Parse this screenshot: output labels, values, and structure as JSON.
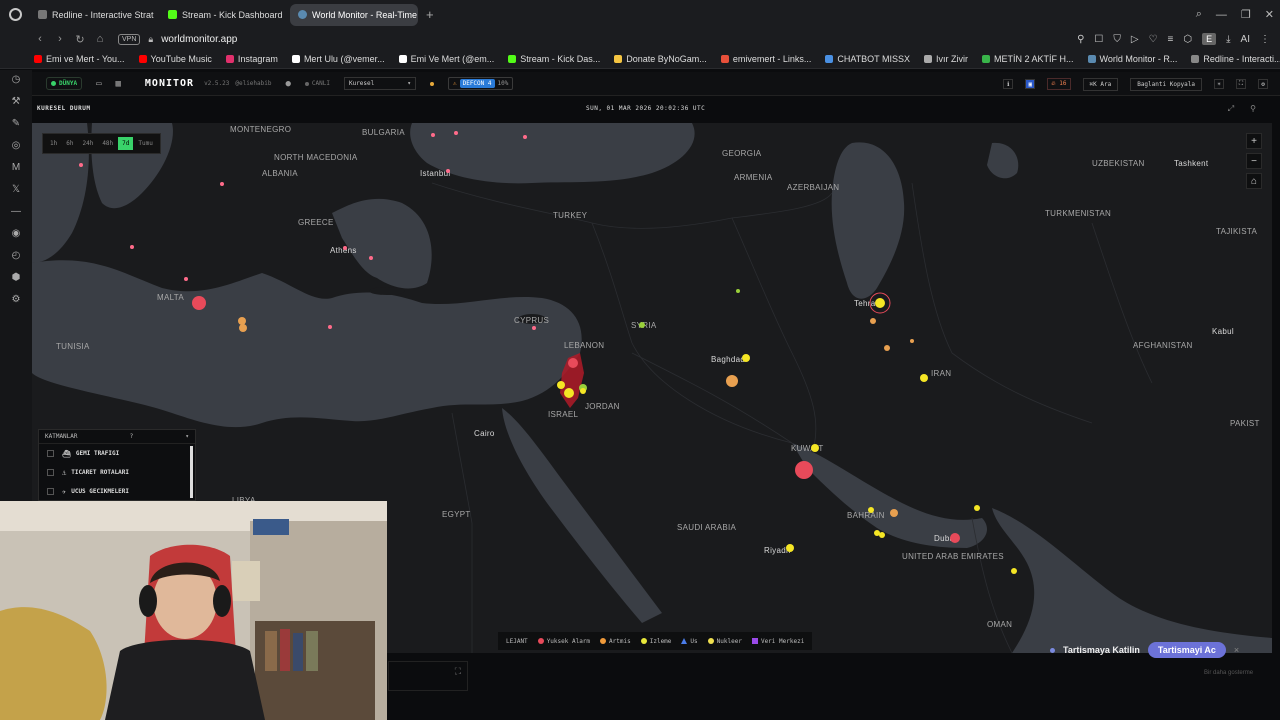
{
  "browser": {
    "tabs": [
      {
        "label": "Redline - Interactive Strat",
        "color": "#888888",
        "active": false
      },
      {
        "label": "Stream - Kick Dashboard",
        "color": "#53fc18",
        "active": false
      },
      {
        "label": "World Monitor - Real-Time",
        "color": "#5a8ab0",
        "active": true
      }
    ],
    "url": "worldmonitor.app",
    "vpn_label": "VPN",
    "ext_label": "AI",
    "e_label": "E",
    "bookmarks": [
      {
        "label": "Emi ve Mert - You...",
        "color": "#ff0000"
      },
      {
        "label": "YouTube Music",
        "color": "#ff0000"
      },
      {
        "label": "Instagram",
        "color": "#e1306c"
      },
      {
        "label": "Mert Ulu (@vemer...",
        "color": "#ffffff"
      },
      {
        "label": "Emi Ve Mert (@em...",
        "color": "#ffffff"
      },
      {
        "label": "Stream - Kick Das...",
        "color": "#53fc18"
      },
      {
        "label": "Donate ByNoGam...",
        "color": "#f5c542"
      },
      {
        "label": "emivemert - Links...",
        "color": "#e8503a"
      },
      {
        "label": "CHATBOT MISSX",
        "color": "#4a90e2"
      },
      {
        "label": "Ivır Zivir",
        "color": "#aaaaaa"
      },
      {
        "label": "METİN 2 AKTİF H...",
        "color": "#39b54a"
      },
      {
        "label": "World Monitor - R...",
        "color": "#5a8ab0"
      },
      {
        "label": "Redline - Interacti...",
        "color": "#888888"
      }
    ]
  },
  "app": {
    "mode_badge": "DÜNYA",
    "brand": "MONITOR",
    "version": "v2.5.23",
    "author": "@eliehabib",
    "live": "CANLI",
    "region": "Kuresel",
    "defcon_label": "DEFCON 4",
    "defcon_pct": "10%",
    "notif_count": "16",
    "search_label": "Ara",
    "copy_link": "Baglanti Kopyala",
    "panel_title": "KURESEL DURUM",
    "datetime": "SUN, 01 MAR 2026 20:02:36 UTC"
  },
  "time_filters": [
    {
      "label": "1h",
      "active": false
    },
    {
      "label": "6h",
      "active": false
    },
    {
      "label": "24h",
      "active": false
    },
    {
      "label": "48h",
      "active": false
    },
    {
      "label": "7d",
      "active": true
    },
    {
      "label": "Tumu",
      "active": false
    }
  ],
  "layers": {
    "title": "KATMANLAR",
    "help": "?",
    "items": [
      {
        "label": "GEMI TRAFIGI",
        "icon": "ship-icon"
      },
      {
        "label": "TICARET ROTALARI",
        "icon": "trade-route-icon"
      },
      {
        "label": "UCUS GECIKMELERI",
        "icon": "flight-icon"
      }
    ]
  },
  "map_labels": [
    {
      "text": "MONTENEGRO",
      "cls": "country"
    },
    {
      "text": "BULGARIA",
      "cls": "country"
    },
    {
      "text": "NORTH MACEDONIA",
      "cls": "country"
    },
    {
      "text": "ALBANIA",
      "cls": "country"
    },
    {
      "text": "GREECE",
      "cls": "country"
    },
    {
      "text": "Istanbul",
      "cls": "city"
    },
    {
      "text": "Athens",
      "cls": "city"
    },
    {
      "text": "TURKEY",
      "cls": "country"
    },
    {
      "text": "GEORGIA",
      "cls": "country"
    },
    {
      "text": "ARMENIA",
      "cls": "country"
    },
    {
      "text": "AZERBAIJAN",
      "cls": "country"
    },
    {
      "text": "UZBEKISTAN",
      "cls": "country"
    },
    {
      "text": "Tashkent",
      "cls": "city"
    },
    {
      "text": "TURKMENISTAN",
      "cls": "country"
    },
    {
      "text": "TAJIKISTA",
      "cls": "country"
    },
    {
      "text": "MALTA",
      "cls": "country"
    },
    {
      "text": "TUNISIA",
      "cls": "country"
    },
    {
      "text": "CYPRUS",
      "cls": "country"
    },
    {
      "text": "SYRIA",
      "cls": "country"
    },
    {
      "text": "LEBANON",
      "cls": "country"
    },
    {
      "text": "Tehran",
      "cls": "city"
    },
    {
      "text": "Kabul",
      "cls": "city"
    },
    {
      "text": "AFGHANISTAN",
      "cls": "country"
    },
    {
      "text": "Baghdad",
      "cls": "city"
    },
    {
      "text": "IRAN",
      "cls": "country"
    },
    {
      "text": "JORDAN",
      "cls": "country"
    },
    {
      "text": "ISRAEL",
      "cls": "country"
    },
    {
      "text": "Cairo",
      "cls": "city"
    },
    {
      "text": "KUWAIT",
      "cls": "country"
    },
    {
      "text": "PAKIST",
      "cls": "country"
    },
    {
      "text": "EGYPT",
      "cls": "country"
    },
    {
      "text": "SAUDI ARABIA",
      "cls": "country"
    },
    {
      "text": "BAHRAIN",
      "cls": "country"
    },
    {
      "text": "Dubai",
      "cls": "city"
    },
    {
      "text": "Riyadh",
      "cls": "city"
    },
    {
      "text": "UNITED ARAB EMIRATES",
      "cls": "country"
    },
    {
      "text": "OMAN",
      "cls": "country"
    },
    {
      "text": "LIBYA",
      "cls": "country"
    }
  ],
  "legend": {
    "title": "LEJANT",
    "items": [
      {
        "label": "Yuksek Alarm",
        "color": "#e84a5a",
        "shape": "dot"
      },
      {
        "label": "Artmis",
        "color": "#f09a3a",
        "shape": "dot"
      },
      {
        "label": "Izleme",
        "color": "#e8e83a",
        "shape": "dot"
      },
      {
        "label": "Us",
        "color": "#4a7ce8",
        "shape": "triangle"
      },
      {
        "label": "Nukleer",
        "color": "#f0e050",
        "shape": "dot"
      },
      {
        "label": "Veri Merkezi",
        "color": "#9a4ae8",
        "shape": "square"
      }
    ]
  },
  "discussion": {
    "text": "Tartismaya Katilin",
    "button": "Tartismayi Ac",
    "close": "×",
    "footnote": "Bir daha gosterme"
  },
  "colors": {
    "accent_green": "#39d36a",
    "alarm_red": "#e84a5a",
    "monitor_yellow": "#f5e625",
    "elevated_orange": "#e8a050",
    "discuss_purple": "#6c72d8"
  }
}
